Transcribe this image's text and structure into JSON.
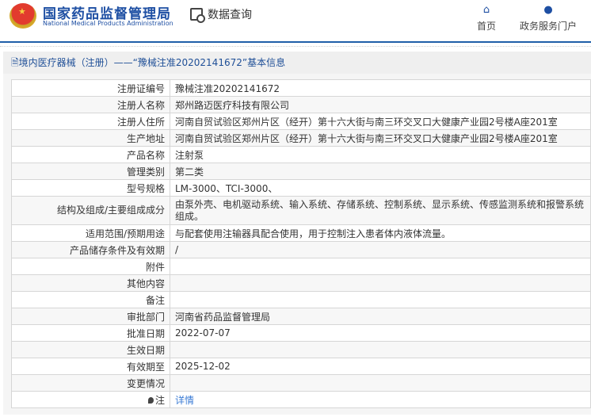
{
  "header": {
    "brand_cn": "国家药品监督管理局",
    "brand_en": "National Medical Products Administration",
    "query_label": "数据查询",
    "nav": [
      {
        "label": "首页",
        "icon": "home-icon"
      },
      {
        "label": "政务服务门户",
        "icon": "user-icon"
      }
    ]
  },
  "title": "境内医疗器械（注册）——“豫械注准20202141672”基本信息",
  "rows": [
    {
      "label": "注册证编号",
      "value": "豫械注准20202141672"
    },
    {
      "label": "注册人名称",
      "value": "郑州路迈医疗科技有限公司"
    },
    {
      "label": "注册人住所",
      "value": "河南自贸试验区郑州片区（经开）第十六大街与南三环交叉口大健康产业园2号楼A座201室"
    },
    {
      "label": "生产地址",
      "value": "河南自贸试验区郑州片区（经开）第十六大街与南三环交叉口大健康产业园2号楼A座201室"
    },
    {
      "label": "产品名称",
      "value": "注射泵"
    },
    {
      "label": "管理类别",
      "value": "第二类"
    },
    {
      "label": "型号规格",
      "value": "LM-3000、TCI-3000、"
    },
    {
      "label": "结构及组成/主要组成成分",
      "value": "由泵外壳、电机驱动系统、输入系统、存储系统、控制系统、显示系统、传感监测系统和报警系统组成。"
    },
    {
      "label": "适用范围/预期用途",
      "value": "与配套使用注输器具配合使用，用于控制注入患者体内液体流量。"
    },
    {
      "label": "产品储存条件及有效期",
      "value": "/"
    },
    {
      "label": "附件",
      "value": ""
    },
    {
      "label": "其他内容",
      "value": ""
    },
    {
      "label": "备注",
      "value": ""
    },
    {
      "label": "审批部门",
      "value": "河南省药品监督管理局"
    },
    {
      "label": "批准日期",
      "value": "2022-07-07"
    },
    {
      "label": "生效日期",
      "value": ""
    },
    {
      "label": "有效期至",
      "value": "2025-12-02"
    },
    {
      "label": "变更情况",
      "value": ""
    }
  ],
  "note": {
    "label": "注",
    "link": "详情"
  }
}
